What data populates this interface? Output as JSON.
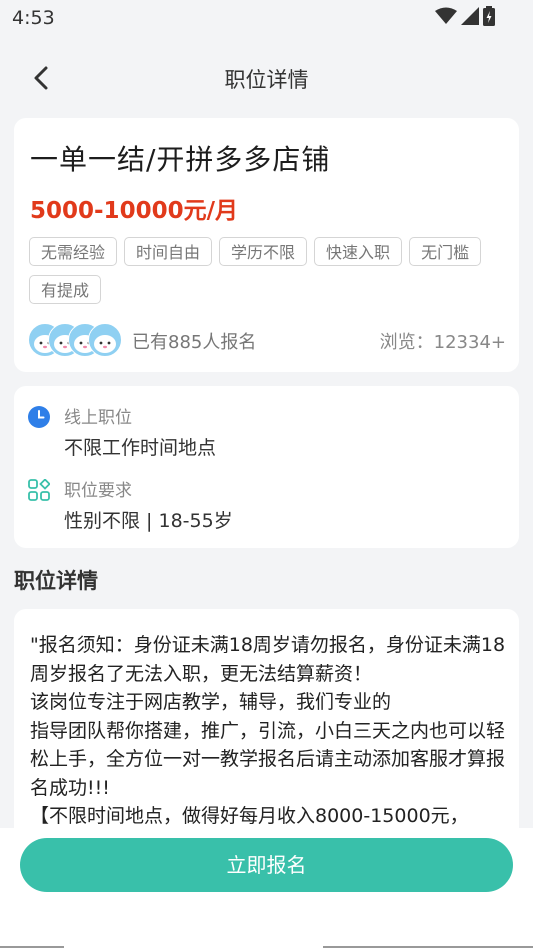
{
  "status": {
    "time": "4:53"
  },
  "nav": {
    "title": "职位详情"
  },
  "job": {
    "title": "一单一结/开拼多多店铺",
    "salary": "5000-10000元/月",
    "tags": [
      "无需经验",
      "时间自由",
      "学历不限",
      "快速入职",
      "无门槛",
      "有提成"
    ],
    "signup_count": "已有885人报名",
    "views": "浏览：12334+"
  },
  "info": {
    "type_label": "线上职位",
    "type_value": "不限工作时间地点",
    "req_label": "职位要求",
    "req_value": "性别不限 | 18-55岁"
  },
  "detail": {
    "section_title": "职位详情",
    "text": "\"报名须知：身份证未满18周岁请勿报名，身份证未满18周岁报名了无法入职，更无法结算薪资！\n该岗位专注于网店教学，辅导，我们专业的\n指导团队帮你搭建，推广，引流，小白三天之内也可以轻松上手，全方位一对一教学报名后请主动添加客服才算报名成功!!!\n【不限时间地点，做得好每月收入8000-15000元，"
  },
  "action": {
    "apply_label": "立即报名"
  },
  "colors": {
    "accent": "#39c0aa",
    "salary": "#e13a1b",
    "info_blue": "#2f7fe8"
  }
}
